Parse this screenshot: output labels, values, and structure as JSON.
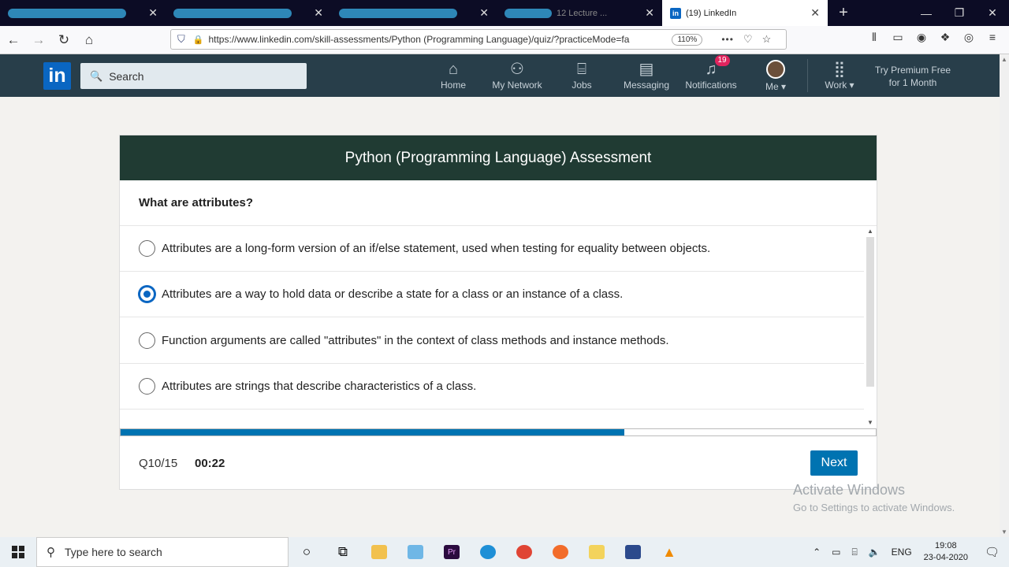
{
  "browser": {
    "tabs": [
      {
        "label": ""
      },
      {
        "label": ""
      },
      {
        "label": ""
      },
      {
        "label": "12 Lecture ..."
      },
      {
        "label": "(19) LinkedIn"
      }
    ],
    "url": "https://www.linkedin.com/skill-assessments/Python (Programming Language)/quiz/?practiceMode=fa",
    "zoom": "110%"
  },
  "linkedin": {
    "logo": "in",
    "search_placeholder": "Search",
    "nav": [
      {
        "label": "Home",
        "icon": "home-icon"
      },
      {
        "label": "My Network",
        "icon": "network-icon"
      },
      {
        "label": "Jobs",
        "icon": "briefcase-icon"
      },
      {
        "label": "Messaging",
        "icon": "messaging-icon"
      },
      {
        "label": "Notifications",
        "icon": "bell-icon",
        "badge": "19"
      },
      {
        "label": "Me",
        "icon": "avatar"
      },
      {
        "label": "Work",
        "icon": "grid-icon"
      }
    ],
    "premium_line1": "Try Premium Free",
    "premium_line2": "for 1 Month"
  },
  "assessment": {
    "title": "Python (Programming Language) Assessment",
    "question": "What are attributes?",
    "options": [
      {
        "text": "Attributes are a long-form version of an if/else statement, used when testing for equality between objects.",
        "selected": false
      },
      {
        "text": "Attributes are a way to hold data or describe a state for a class or an instance of a class.",
        "selected": true
      },
      {
        "text": "Function arguments are called \"attributes\" in the context of class methods and instance methods.",
        "selected": false
      },
      {
        "text": "Attributes are strings that describe characteristics of a class.",
        "selected": false
      }
    ],
    "progress_fraction": 0.6667,
    "question_counter": "Q10/15",
    "timer": "00:22",
    "next_label": "Next"
  },
  "watermark": {
    "line1": "Activate Windows",
    "line2": "Go to Settings to activate Windows."
  },
  "taskbar": {
    "search_placeholder": "Type here to search",
    "language": "ENG",
    "time": "19:08",
    "date": "23-04-2020"
  },
  "colors": {
    "linkedin_blue": "#0a66c2",
    "header_dark": "#283e4a",
    "card_head": "#203b33",
    "progress": "#0073b1"
  }
}
